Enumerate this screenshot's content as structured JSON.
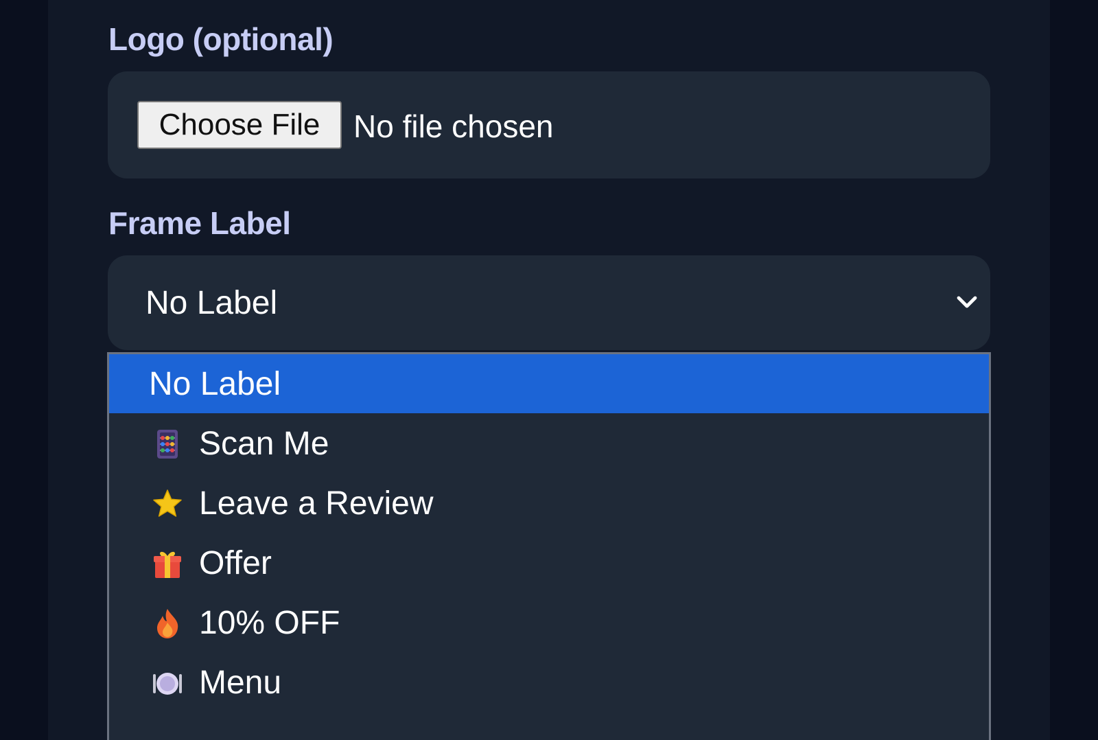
{
  "logo_field": {
    "label": "Logo (optional)",
    "button_label": "Choose File",
    "status": "No file chosen"
  },
  "frame_label_field": {
    "label": "Frame Label",
    "selected_value": "No Label",
    "options": [
      {
        "label": "No Label",
        "icon": "",
        "selected": true
      },
      {
        "label": "Scan Me",
        "icon": "abacus-icon",
        "selected": false
      },
      {
        "label": "Leave a Review",
        "icon": "star-icon",
        "selected": false
      },
      {
        "label": "Offer",
        "icon": "gift-icon",
        "selected": false
      },
      {
        "label": "10% OFF",
        "icon": "fire-icon",
        "selected": false
      },
      {
        "label": "Menu",
        "icon": "plate-icon",
        "selected": false
      }
    ]
  },
  "colors": {
    "page_background": "#0a0f1e",
    "panel_background": "#111827",
    "field_background": "#1f2937",
    "label_color": "#c7cdf5",
    "selected_option": "#1c64d6"
  }
}
